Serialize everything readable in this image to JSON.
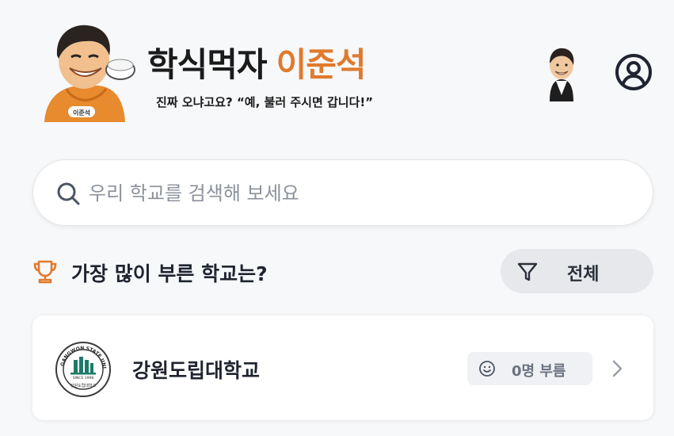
{
  "brand": {
    "title_main": "학식먹자",
    "title_accent": "이준석",
    "tagline": "진짜 오냐고요? “예, 불러 주시면 갑니다!”",
    "mascot_badge": "이준석",
    "accent_color": "#e07a2e"
  },
  "header": {
    "profile_icon": "user-circle-icon"
  },
  "search": {
    "placeholder": "우리 학교를 검색해 보세요",
    "icon": "search-icon"
  },
  "ranking": {
    "title": "가장 많이 부른 학교는?",
    "icon": "trophy-icon",
    "filter_label": "전체",
    "filter_icon": "filter-icon"
  },
  "schools": [
    {
      "name": "강원도립대학교",
      "count_label": "0명 부름",
      "emblem_text_top": "GANGWON STATE UNIVERSITY",
      "emblem_text_since": "SINCE 1998",
      "emblem_text_bottom": "강원도립대학교"
    }
  ]
}
